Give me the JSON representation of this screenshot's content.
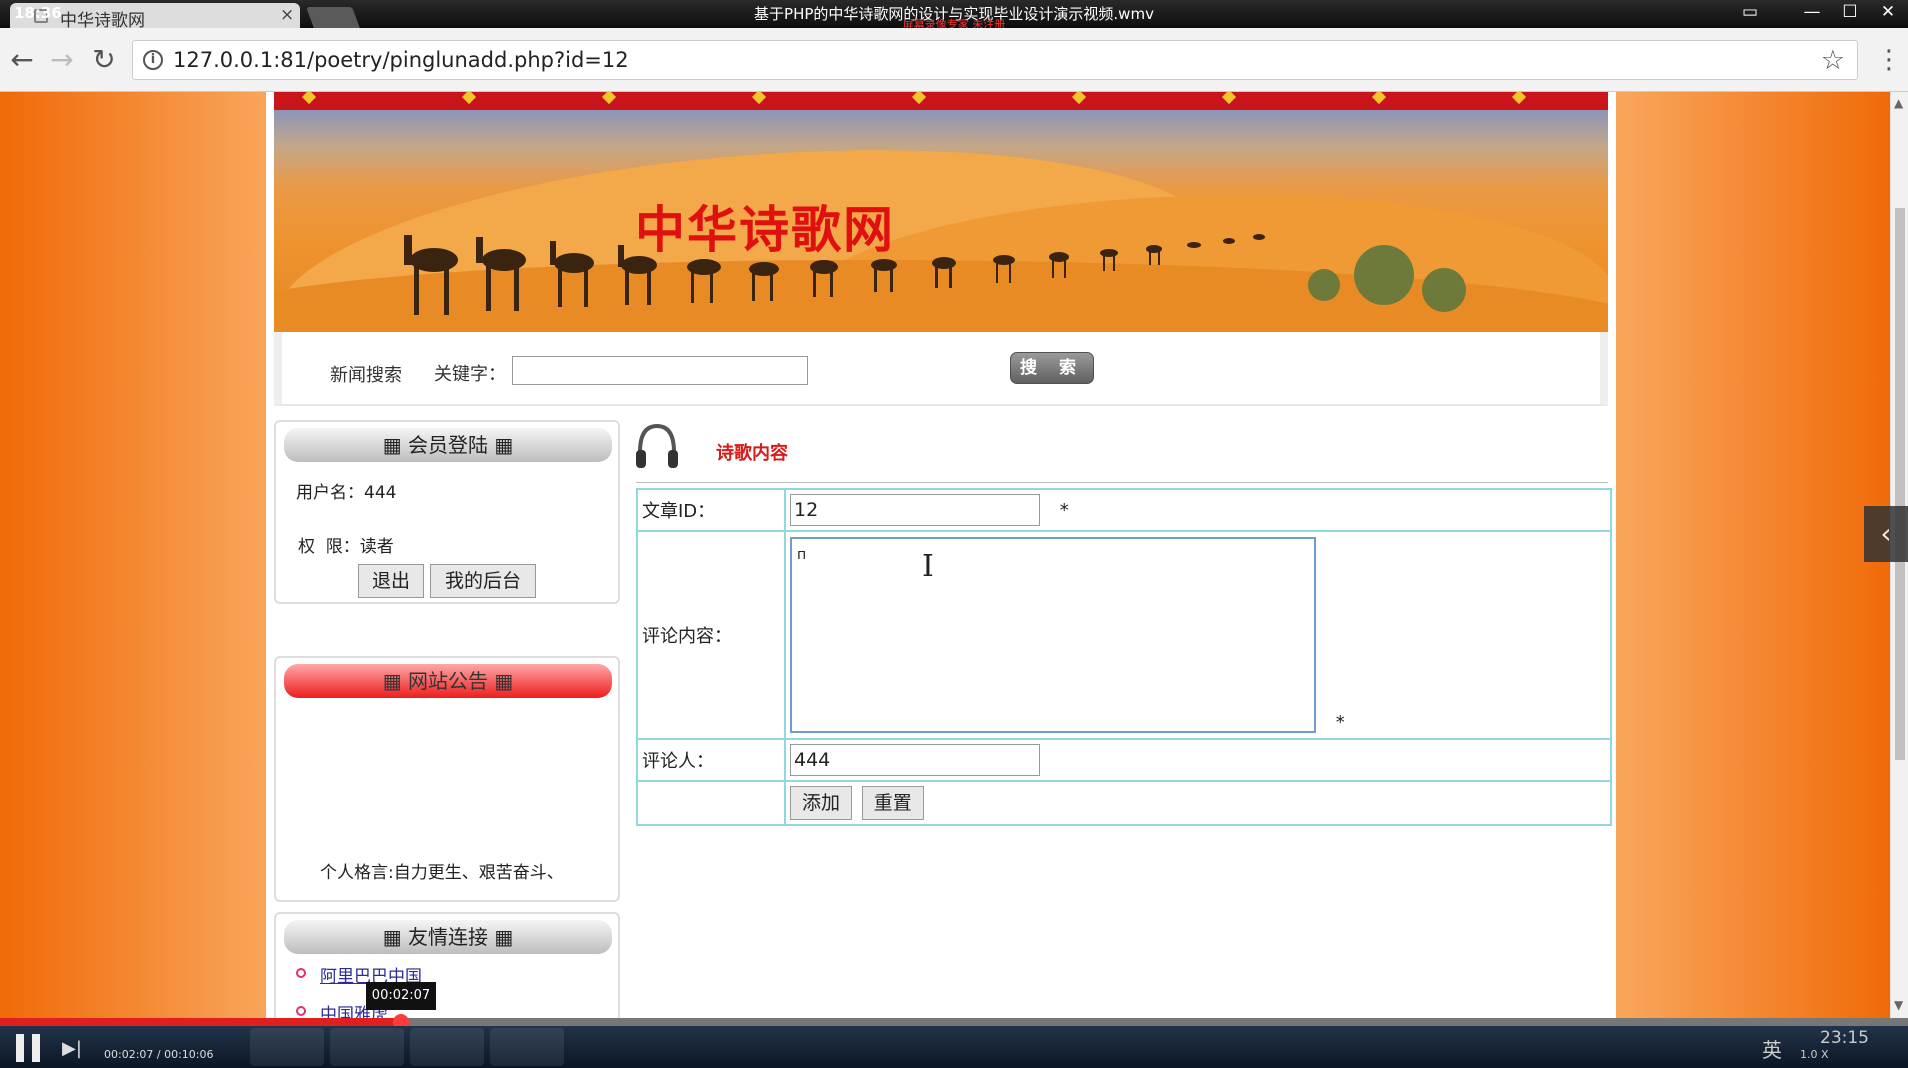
{
  "player": {
    "clock": "18:36",
    "video_title": "基于PHP的中华诗歌网的设计与实现毕业设计演示视频.wmv",
    "watermark": "屏幕录像专家 未注册",
    "time_tooltip": "00:02:07",
    "time_readout": "00:02:07 / 00:10:06",
    "progress_fraction": 0.21,
    "tray_clock": "23:15",
    "tray_speed": "1.0 X",
    "tray_ime": "英"
  },
  "browser": {
    "tab_title": "中华诗歌网",
    "tab_close": "×",
    "url": "127.0.0.1:81/poetry/pinglunadd.php?id=12"
  },
  "site": {
    "title": "中华诗歌网",
    "search": {
      "label": "新闻搜索",
      "keyword_label": "关键字：",
      "keyword_value": "",
      "button_label": "搜 索"
    },
    "login_box": {
      "header": "会员登陆",
      "username_line": "用户名：444",
      "role_line": "权  限：读者",
      "logout_button": "退出",
      "backend_button": "我的后台"
    },
    "notice_box": {
      "header": "网站公告",
      "text": "个人格言:自力更生、艰苦奋斗、"
    },
    "links_box": {
      "header": "友情连接",
      "links": [
        "阿里巴巴中国",
        "中国雅虎"
      ]
    },
    "content": {
      "title": "诗歌内容",
      "fields": {
        "article_id_label": "文章ID：",
        "article_id_value": "12",
        "required_mark": "*",
        "comment_label": "评论内容：",
        "comment_value": "п",
        "commenter_label": "评论人：",
        "commenter_value": "444"
      },
      "add_button": "添加",
      "reset_button": "重置"
    }
  },
  "colors": {
    "page_bg": "#f57d14",
    "accent_red": "#d81a1a",
    "table_border": "#8fd8dd"
  }
}
